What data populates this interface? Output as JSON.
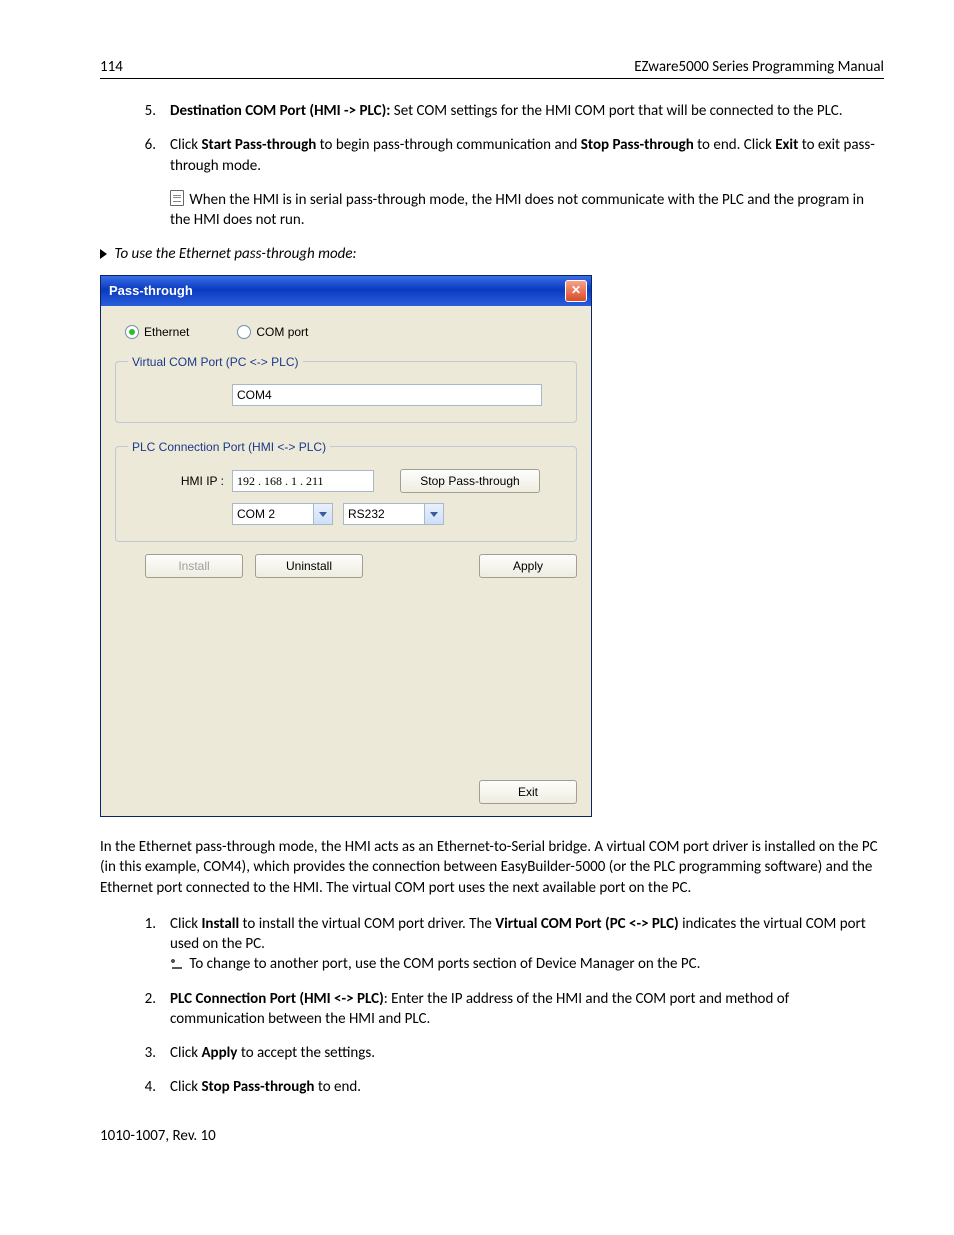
{
  "header": {
    "page_no": "114",
    "title": "EZware5000 Series Programming Manual"
  },
  "list_a": {
    "i5": {
      "num": "5.",
      "bold": "Destination COM Port (HMI -> PLC):",
      "rest": " Set COM settings for the HMI COM port that will be connected to the PLC."
    },
    "i6": {
      "num": "6.",
      "pre": "Click ",
      "b1": "Start Pass-through",
      "mid1": " to begin pass-through communication and ",
      "b2": "Stop Pass-through",
      "mid2": " to end. Click ",
      "b3": "Exit",
      "end": " to exit pass-through mode.",
      "note": " When the HMI is in serial pass-through mode, the HMI does not communicate with the PLC and the program in the HMI does not run."
    }
  },
  "sub_heading": "To use the Ethernet pass-through mode:",
  "dialog": {
    "title": "Pass-through",
    "radios": {
      "ethernet": "Ethernet",
      "comport": "COM port"
    },
    "grp1": {
      "legend": "Virtual COM Port (PC <-> PLC)",
      "value": "COM4"
    },
    "grp2": {
      "legend": "PLC Connection Port (HMI <-> PLC)",
      "hmi_label": "HMI IP :",
      "hmi_ip": "192 . 168 .   1   . 211",
      "stop_btn": "Stop Pass-through",
      "com_sel": "COM 2",
      "proto_sel": "RS232"
    },
    "buttons": {
      "install": "Install",
      "uninstall": "Uninstall",
      "apply": "Apply",
      "exit": "Exit"
    }
  },
  "para_after": "In the Ethernet pass-through mode, the HMI acts as an Ethernet-to-Serial bridge. A virtual COM port driver is installed on the PC (in this example, COM4), which provides the connection between EasyBuilder-5000 (or the PLC programming software) and the Ethernet port connected to the HMI. The virtual COM port uses the next available port on the PC.",
  "list_b": {
    "i1": {
      "num": "1.",
      "pre": "Click ",
      "b1": "Install",
      "mid": " to install the virtual COM port driver. The ",
      "b2": "Virtual COM Port (PC <-> PLC)",
      "end": " indicates the virtual COM port used on the PC.",
      "note": " To change to another port, use the COM ports section of Device Manager on the PC."
    },
    "i2": {
      "num": "2.",
      "b1": "PLC Connection Port (HMI <-> PLC)",
      "rest": ": Enter the IP address of the HMI and the COM port and method of communication between the HMI and PLC."
    },
    "i3": {
      "num": "3.",
      "pre": "Click ",
      "b1": "Apply",
      "rest": " to accept the settings."
    },
    "i4": {
      "num": "4.",
      "pre": "Click ",
      "b1": "Stop Pass-through",
      "rest": " to end."
    }
  },
  "footer": "1010-1007, Rev. 10"
}
